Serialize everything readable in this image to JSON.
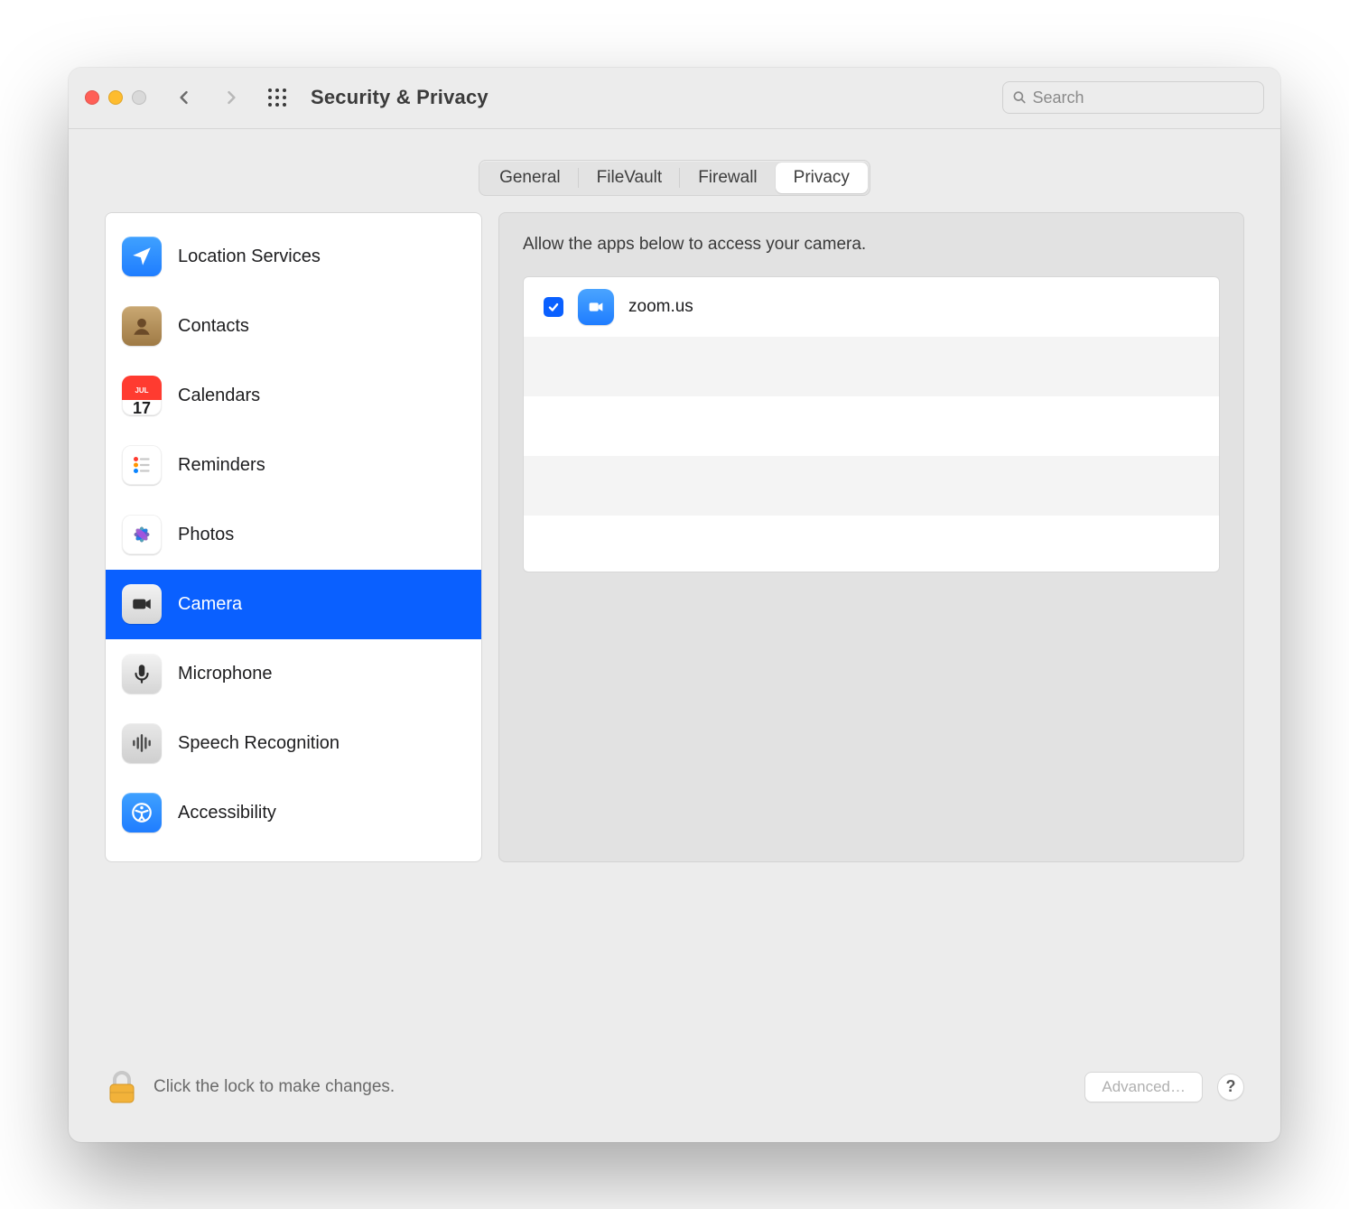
{
  "window": {
    "title": "Security & Privacy"
  },
  "search": {
    "placeholder": "Search"
  },
  "tabs": [
    {
      "id": "general",
      "label": "General",
      "active": false
    },
    {
      "id": "filevault",
      "label": "FileVault",
      "active": false
    },
    {
      "id": "firewall",
      "label": "Firewall",
      "active": false
    },
    {
      "id": "privacy",
      "label": "Privacy",
      "active": true
    }
  ],
  "sidebar": {
    "items": [
      {
        "id": "location",
        "label": "Location Services",
        "icon": "location-arrow",
        "bg": "linear-gradient(180deg,#3fa1ff 0%,#1f7dff 100%)",
        "selected": false
      },
      {
        "id": "contacts",
        "label": "Contacts",
        "icon": "contacts",
        "bg": "linear-gradient(180deg,#c9a873 0%,#9f7a45 100%)",
        "selected": false
      },
      {
        "id": "calendars",
        "label": "Calendars",
        "icon": "calendar",
        "bg": "#ffffff",
        "selected": false
      },
      {
        "id": "reminders",
        "label": "Reminders",
        "icon": "reminders",
        "bg": "#ffffff",
        "selected": false
      },
      {
        "id": "photos",
        "label": "Photos",
        "icon": "photos",
        "bg": "#ffffff",
        "selected": false
      },
      {
        "id": "camera",
        "label": "Camera",
        "icon": "camera",
        "bg": "linear-gradient(180deg,#f3f3f3 0%,#d5d5d5 100%)",
        "selected": true
      },
      {
        "id": "microphone",
        "label": "Microphone",
        "icon": "microphone",
        "bg": "linear-gradient(180deg,#f3f3f3 0%,#d5d5d5 100%)",
        "selected": false
      },
      {
        "id": "speech",
        "label": "Speech Recognition",
        "icon": "waveform",
        "bg": "linear-gradient(180deg,#e8e8e8 0%,#cfcfcf 100%)",
        "selected": false
      },
      {
        "id": "accessibility",
        "label": "Accessibility",
        "icon": "accessibility",
        "bg": "linear-gradient(180deg,#3fa1ff 0%,#1f7dff 100%)",
        "selected": false
      }
    ]
  },
  "detail": {
    "heading": "Allow the apps below to access your camera.",
    "apps": [
      {
        "name": "zoom.us",
        "checked": true,
        "icon": "zoom"
      }
    ],
    "visible_rows": 5
  },
  "footer": {
    "lock_text": "Click the lock to make changes.",
    "advanced_label": "Advanced…",
    "help_label": "?"
  },
  "calendar_icon": {
    "month": "JUL",
    "day": "17"
  },
  "colors": {
    "accent": "#0a60ff"
  }
}
